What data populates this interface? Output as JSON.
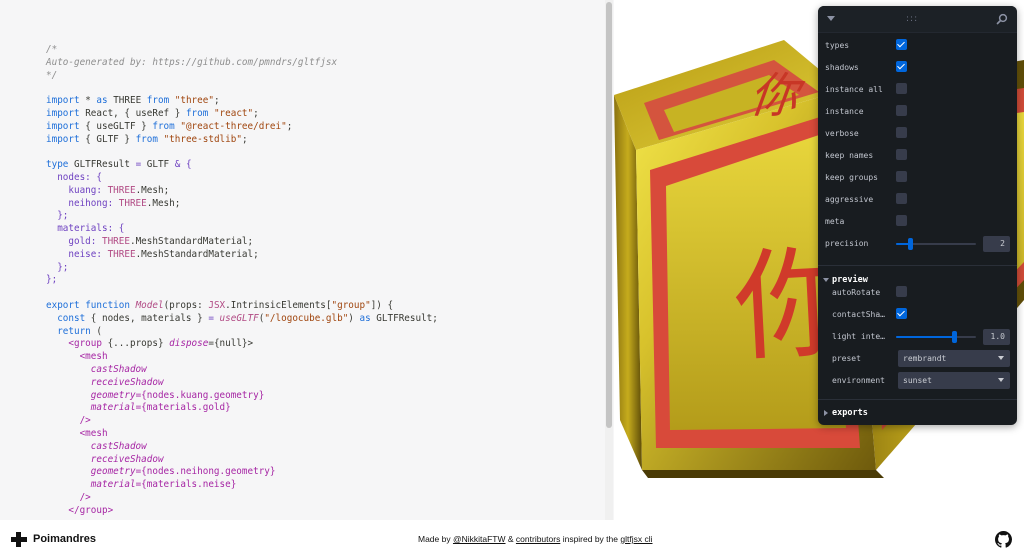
{
  "code": {
    "lines": [
      [
        {
          "t": "/*",
          "c": "cm"
        }
      ],
      [
        {
          "t": "Auto-generated by: https://github.com/pmndrs/gltfjsx",
          "c": "cm"
        }
      ],
      [
        {
          "t": "*/",
          "c": "cm"
        }
      ],
      [],
      [
        {
          "t": "import",
          "c": "kw"
        },
        {
          "t": " * ",
          "c": "pl"
        },
        {
          "t": "as",
          "c": "kw"
        },
        {
          "t": " THREE ",
          "c": "pl"
        },
        {
          "t": "from",
          "c": "kw"
        },
        {
          "t": " \"three\"",
          "c": "st"
        },
        {
          "t": ";",
          "c": "pl"
        }
      ],
      [
        {
          "t": "import",
          "c": "kw"
        },
        {
          "t": " React, { useRef } ",
          "c": "pl"
        },
        {
          "t": "from",
          "c": "kw"
        },
        {
          "t": " \"react\"",
          "c": "st"
        },
        {
          "t": ";",
          "c": "pl"
        }
      ],
      [
        {
          "t": "import",
          "c": "kw"
        },
        {
          "t": " { useGLTF } ",
          "c": "pl"
        },
        {
          "t": "from",
          "c": "kw"
        },
        {
          "t": " \"@react-three/drei\"",
          "c": "st"
        },
        {
          "t": ";",
          "c": "pl"
        }
      ],
      [
        {
          "t": "import",
          "c": "kw"
        },
        {
          "t": " { GLTF } ",
          "c": "pl"
        },
        {
          "t": "from",
          "c": "kw"
        },
        {
          "t": " \"three-stdlib\"",
          "c": "st"
        },
        {
          "t": ";",
          "c": "pl"
        }
      ],
      [],
      [
        {
          "t": "type",
          "c": "kw"
        },
        {
          "t": " GLTFResult ",
          "c": "pl"
        },
        {
          "t": "=",
          "c": "pu"
        },
        {
          "t": " GLTF ",
          "c": "pl"
        },
        {
          "t": "& {",
          "c": "pu"
        }
      ],
      [
        {
          "t": "  nodes: {",
          "c": "pu"
        }
      ],
      [
        {
          "t": "    kuang: ",
          "c": "pu"
        },
        {
          "t": "THREE",
          "c": "ty"
        },
        {
          "t": ".Mesh;",
          "c": "pl"
        }
      ],
      [
        {
          "t": "    neihong: ",
          "c": "pu"
        },
        {
          "t": "THREE",
          "c": "ty"
        },
        {
          "t": ".Mesh;",
          "c": "pl"
        }
      ],
      [
        {
          "t": "  };",
          "c": "pu"
        }
      ],
      [
        {
          "t": "  materials: {",
          "c": "pu"
        }
      ],
      [
        {
          "t": "    gold: ",
          "c": "pu"
        },
        {
          "t": "THREE",
          "c": "ty"
        },
        {
          "t": ".MeshStandardMaterial;",
          "c": "pl"
        }
      ],
      [
        {
          "t": "    neise: ",
          "c": "pu"
        },
        {
          "t": "THREE",
          "c": "ty"
        },
        {
          "t": ".MeshStandardMaterial;",
          "c": "pl"
        }
      ],
      [
        {
          "t": "  };",
          "c": "pu"
        }
      ],
      [
        {
          "t": "};",
          "c": "pu"
        }
      ],
      [],
      [
        {
          "t": "export",
          "c": "kw"
        },
        {
          "t": " function ",
          "c": "kw"
        },
        {
          "t": "Model",
          "c": "fn"
        },
        {
          "t": "(props: ",
          "c": "pl"
        },
        {
          "t": "JSX",
          "c": "ty"
        },
        {
          "t": ".IntrinsicElements[",
          "c": "pl"
        },
        {
          "t": "\"group\"",
          "c": "st"
        },
        {
          "t": "]) {",
          "c": "pl"
        }
      ],
      [
        {
          "t": "  const",
          "c": "kw"
        },
        {
          "t": " { nodes, materials } ",
          "c": "pl"
        },
        {
          "t": "=",
          "c": "pu"
        },
        {
          "t": " useGLTF",
          "c": "fn"
        },
        {
          "t": "(",
          "c": "pl"
        },
        {
          "t": "\"/logocube.glb\"",
          "c": "st"
        },
        {
          "t": ") ",
          "c": "pl"
        },
        {
          "t": "as",
          "c": "kw"
        },
        {
          "t": " GLTFResult;",
          "c": "pl"
        }
      ],
      [
        {
          "t": "  return",
          "c": "kw"
        },
        {
          "t": " (",
          "c": "pl"
        }
      ],
      [
        {
          "t": "    <group ",
          "c": "tg"
        },
        {
          "t": "{...props} ",
          "c": "pl"
        },
        {
          "t": "dispose",
          "c": "at"
        },
        {
          "t": "={null}>",
          "c": "pl"
        }
      ],
      [
        {
          "t": "      <mesh",
          "c": "tg"
        }
      ],
      [
        {
          "t": "        castShadow",
          "c": "at"
        }
      ],
      [
        {
          "t": "        receiveShadow",
          "c": "at"
        }
      ],
      [
        {
          "t": "        geometry",
          "c": "at"
        },
        {
          "t": "={nodes.kuang.geometry}",
          "c": "tg"
        }
      ],
      [
        {
          "t": "        material",
          "c": "at"
        },
        {
          "t": "={materials.gold}",
          "c": "tg"
        }
      ],
      [
        {
          "t": "      />",
          "c": "tg"
        }
      ],
      [
        {
          "t": "      <mesh",
          "c": "tg"
        }
      ],
      [
        {
          "t": "        castShadow",
          "c": "at"
        }
      ],
      [
        {
          "t": "        receiveShadow",
          "c": "at"
        }
      ],
      [
        {
          "t": "        geometry",
          "c": "at"
        },
        {
          "t": "={nodes.neihong.geometry}",
          "c": "tg"
        }
      ],
      [
        {
          "t": "        material",
          "c": "at"
        },
        {
          "t": "={materials.neise}",
          "c": "tg"
        }
      ],
      [
        {
          "t": "      />",
          "c": "tg"
        }
      ],
      [
        {
          "t": "    </group>",
          "c": "tg"
        }
      ]
    ]
  },
  "viewport": {
    "glyph": "你",
    "colors": {
      "gold": "#c8b21a",
      "red": "#d84a3a"
    }
  },
  "panel": {
    "drag_handle": ":::",
    "settings": {
      "types": {
        "label": "types",
        "checked": true
      },
      "shadows": {
        "label": "shadows",
        "checked": true
      },
      "instance_all": {
        "label": "instance all",
        "checked": false
      },
      "instance": {
        "label": "instance",
        "checked": false
      },
      "verbose": {
        "label": "verbose",
        "checked": false
      },
      "keep_names": {
        "label": "keep names",
        "checked": false
      },
      "keep_groups": {
        "label": "keep groups",
        "checked": false
      },
      "aggressive": {
        "label": "aggressive",
        "checked": false
      },
      "meta": {
        "label": "meta",
        "checked": false
      },
      "precision": {
        "label": "precision",
        "value": "2",
        "fraction": 0.18
      }
    },
    "preview": {
      "title": "preview",
      "autoRotate": {
        "label": "autoRotate",
        "checked": false
      },
      "contactShadow": {
        "label": "contactShadow",
        "checked": true
      },
      "light_intensity": {
        "label": "light intensity",
        "value": "1.0",
        "fraction": 0.72
      },
      "preset": {
        "label": "preset",
        "value": "rembrandt"
      },
      "environment": {
        "label": "environment",
        "value": "sunset"
      }
    },
    "exports": {
      "title": "exports"
    }
  },
  "footer": {
    "brand": "Poimandres",
    "made_by": "Made by ",
    "author_link": "@NikkitaFTW",
    "and": " & ",
    "contributors_link": "contributors",
    "inspired": " inspired by the ",
    "cli_link": "gltfjsx cli"
  }
}
